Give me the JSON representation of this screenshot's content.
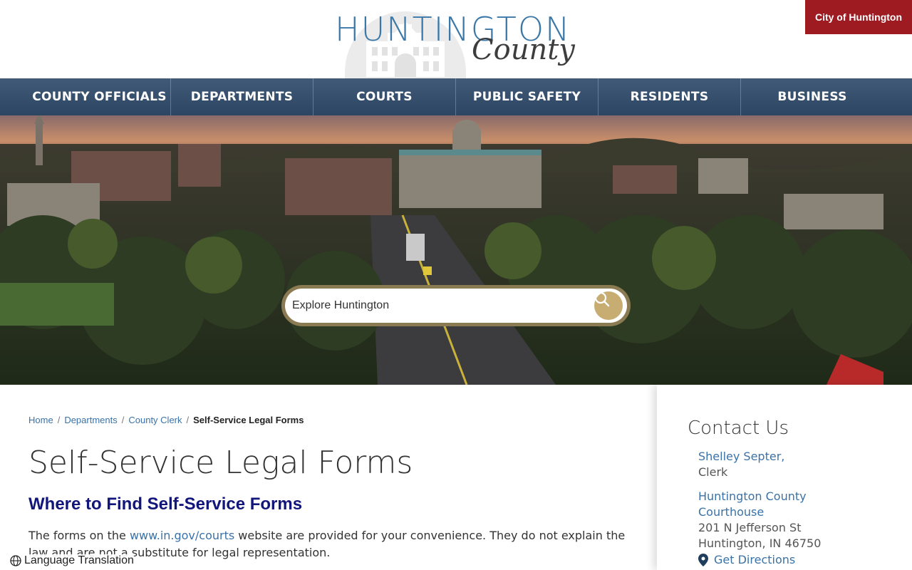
{
  "header": {
    "logo_main": "HUNTINGTON",
    "logo_script": "County",
    "city_link": "City of Huntington"
  },
  "nav": {
    "items": [
      "COUNTY OFFICIALS",
      "DEPARTMENTS",
      "COURTS",
      "PUBLIC SAFETY",
      "RESIDENTS",
      "BUSINESS"
    ]
  },
  "search": {
    "placeholder": "Explore Huntington",
    "icon": "search-icon"
  },
  "breadcrumb": {
    "items": [
      "Home",
      "Departments",
      "County Clerk"
    ],
    "separator": "/",
    "current": "Self-Service Legal Forms"
  },
  "main": {
    "title": "Self-Service Legal Forms",
    "heading": "Where to Find Self-Service Forms",
    "intro_before": "The forms on the ",
    "intro_link": "www.in.gov/courts",
    "intro_after": " website are provided for your convenience. They do not explain the law and are not a substitute for legal representation."
  },
  "sidebar": {
    "title": "Contact Us",
    "name": "Shelley Septer,",
    "role": "Clerk",
    "location_link_line1": "Huntington County",
    "location_link_line2": "Courthouse",
    "address_line1": "201 N Jefferson St",
    "address_line2": "Huntington, IN 46750",
    "directions": "Get Directions"
  },
  "footer": {
    "language": "Language Translation"
  },
  "colors": {
    "nav": "#2c4562",
    "city_button": "#9e1b22",
    "search_button": "#c8ad72",
    "heading": "#12157a",
    "link": "#3a72a8"
  }
}
